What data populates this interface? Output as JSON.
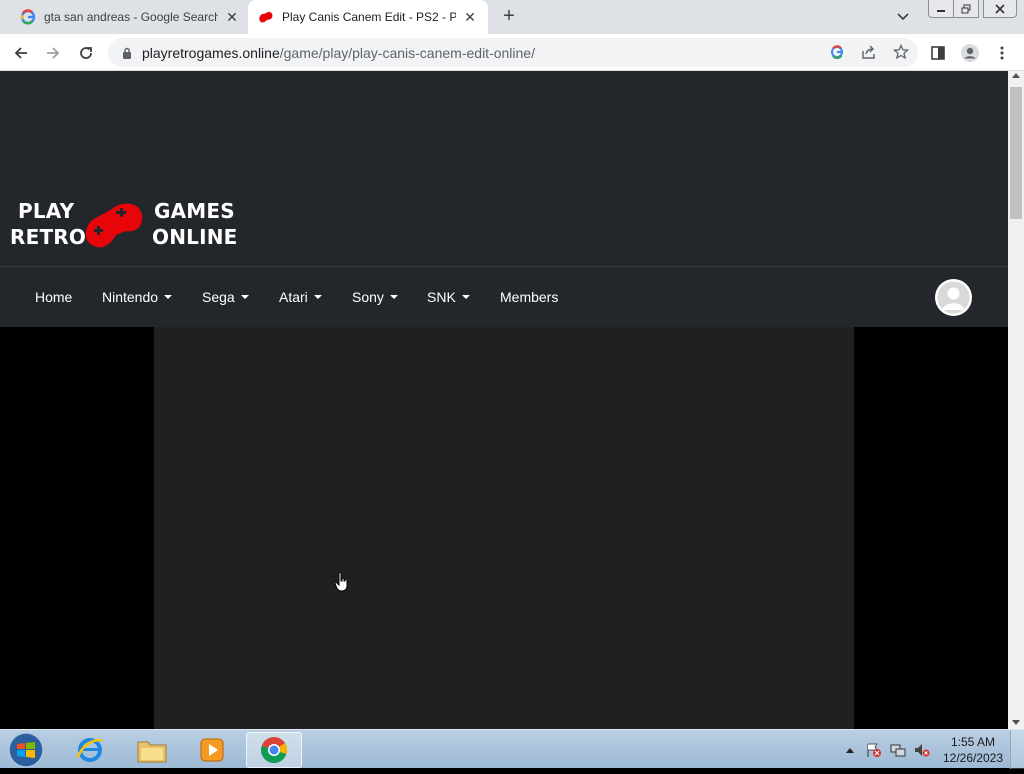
{
  "browser": {
    "tabs": [
      {
        "title": "gta san andreas - Google Search",
        "favicon": "google-icon",
        "active": false
      },
      {
        "title": "Play Canis Canem Edit - PS2 - Pla",
        "favicon": "retro-gamepad-icon",
        "active": true
      }
    ],
    "address": {
      "domain": "playretrogames.online",
      "path": "/game/play/play-canis-canem-edit-online/"
    }
  },
  "site": {
    "logo": {
      "line1_left": "PLAY",
      "line2_left": "RETRO",
      "line1_right": "GAMES",
      "line2_right": "ONLINE",
      "gamepad_color": "#e8050a"
    },
    "nav": [
      {
        "label": "Home",
        "dropdown": false
      },
      {
        "label": "Nintendo",
        "dropdown": true
      },
      {
        "label": "Sega",
        "dropdown": true
      },
      {
        "label": "Atari",
        "dropdown": true
      },
      {
        "label": "Sony",
        "dropdown": true
      },
      {
        "label": "SNK",
        "dropdown": true
      },
      {
        "label": "Members",
        "dropdown": false
      }
    ],
    "colors": {
      "header_bg": "#23272b",
      "game_bg": "#202020",
      "page_bg": "#000000"
    }
  },
  "taskbar": {
    "apps": [
      "internet-explorer-icon",
      "file-explorer-icon",
      "media-player-icon",
      "chrome-icon"
    ],
    "clock": {
      "time": "1:55 AM",
      "date": "12/26/2023"
    }
  }
}
